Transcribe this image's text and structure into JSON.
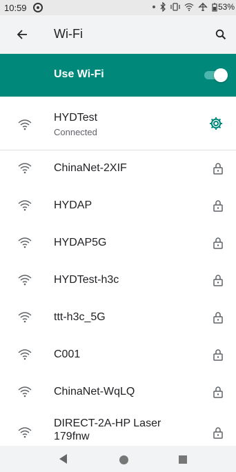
{
  "status_bar": {
    "time": "10:59",
    "battery": "53%"
  },
  "app_bar": {
    "title": "Wi-Fi"
  },
  "use_wifi": {
    "label": "Use Wi-Fi",
    "enabled": true
  },
  "connected": {
    "name": "HYDTest",
    "status": "Connected"
  },
  "networks": [
    {
      "name": "ChinaNet-2XIF",
      "secured": true
    },
    {
      "name": "HYDAP",
      "secured": true
    },
    {
      "name": "HYDAP5G",
      "secured": true
    },
    {
      "name": "HYDTest-h3c",
      "secured": true
    },
    {
      "name": "ttt-h3c_5G",
      "secured": true
    },
    {
      "name": "C001",
      "secured": true
    },
    {
      "name": "ChinaNet-WqLQ",
      "secured": true
    },
    {
      "name": "DIRECT-2A-HP Laser 179fnw",
      "secured": true
    }
  ],
  "colors": {
    "accent": "#00897b",
    "toggle_track": "#4db6ac"
  }
}
